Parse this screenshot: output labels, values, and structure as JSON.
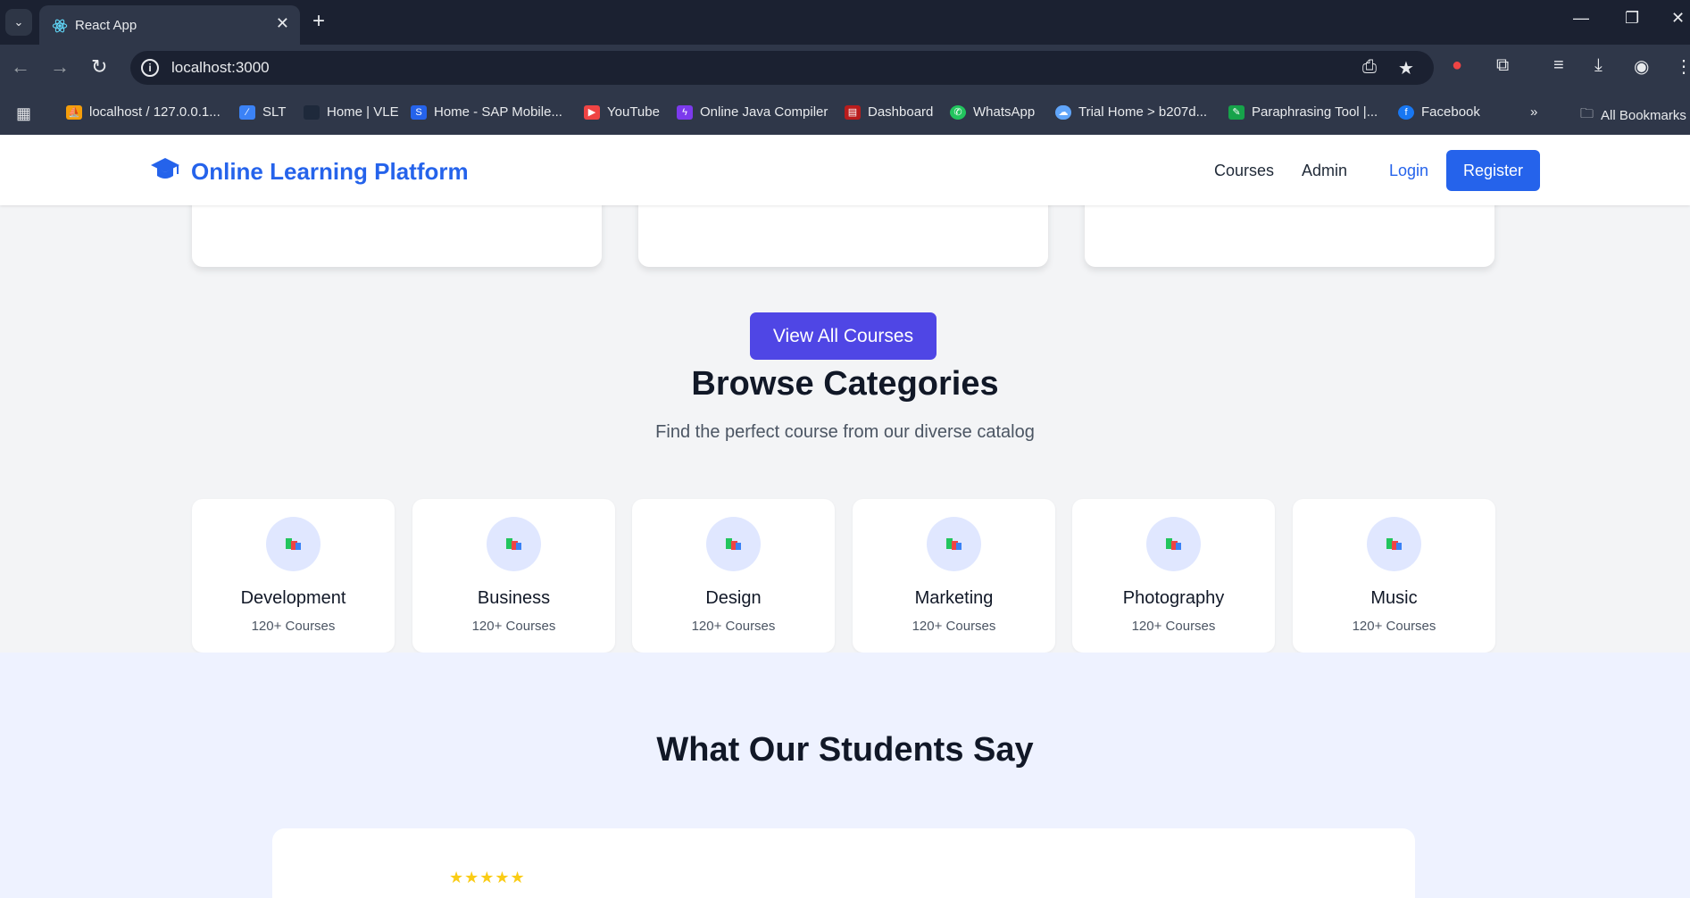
{
  "browser": {
    "tab_title": "React App",
    "url": "localhost:3000",
    "bookmarks": [
      {
        "label": "localhost / 127.0.0.1..."
      },
      {
        "label": "SLT"
      },
      {
        "label": "Home | VLE"
      },
      {
        "label": "Home - SAP Mobile..."
      },
      {
        "label": "YouTube"
      },
      {
        "label": "Online Java Compiler"
      },
      {
        "label": "Dashboard"
      },
      {
        "label": "WhatsApp"
      },
      {
        "label": "Trial Home > b207d..."
      },
      {
        "label": "Paraphrasing Tool |..."
      },
      {
        "label": "Facebook"
      }
    ],
    "all_bookmarks": "All Bookmarks"
  },
  "header": {
    "logo_text": "Online Learning Platform",
    "nav": {
      "courses": "Courses",
      "admin": "Admin",
      "login": "Login",
      "register": "Register"
    }
  },
  "courses": {
    "view_all": "View All Courses"
  },
  "categories": {
    "title": "Browse Categories",
    "subtitle": "Find the perfect course from our diverse catalog",
    "items": [
      {
        "name": "Development",
        "count": "120+ Courses"
      },
      {
        "name": "Business",
        "count": "120+ Courses"
      },
      {
        "name": "Design",
        "count": "120+ Courses"
      },
      {
        "name": "Marketing",
        "count": "120+ Courses"
      },
      {
        "name": "Photography",
        "count": "120+ Courses"
      },
      {
        "name": "Music",
        "count": "120+ Courses"
      }
    ]
  },
  "testimonials": {
    "title": "What Our Students Say",
    "stars": "★★★★★"
  },
  "colors": {
    "brand": "#2563eb",
    "accent": "#4f46e5",
    "star": "#facc15"
  }
}
